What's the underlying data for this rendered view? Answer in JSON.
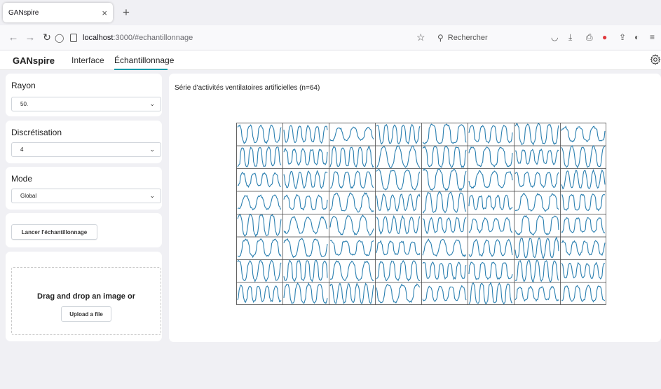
{
  "browser": {
    "tab_title": "GANspire",
    "tab_close": "×",
    "new_tab": "+",
    "url_host": "localhost",
    "url_rest": ":3000/#echantillonnage",
    "search_placeholder": "Rechercher"
  },
  "app": {
    "brand": "GANspire",
    "tabs": [
      {
        "label": "Interface"
      },
      {
        "label": "Échantillonnage",
        "active": true
      }
    ]
  },
  "sidebar": {
    "rayon": {
      "label": "Rayon",
      "value": "50."
    },
    "discretisation": {
      "label": "Discrétisation",
      "value": "4"
    },
    "mode": {
      "label": "Mode",
      "value": "Global"
    },
    "launch_button": "Lancer l'échantillonnage",
    "dropzone": {
      "text": "Drag and drop an image or",
      "upload_button": "Upload a file"
    }
  },
  "panel": {
    "title": "Série d'activités ventilatoires artificielles (n=64)"
  },
  "chart_data": {
    "type": "line",
    "grid": {
      "rows": 8,
      "cols": 8
    },
    "series_count": 64,
    "line_color": "#2a7fb0"
  },
  "colors": {
    "accent": "#0d9aa8",
    "series": "#2a7fb0"
  }
}
